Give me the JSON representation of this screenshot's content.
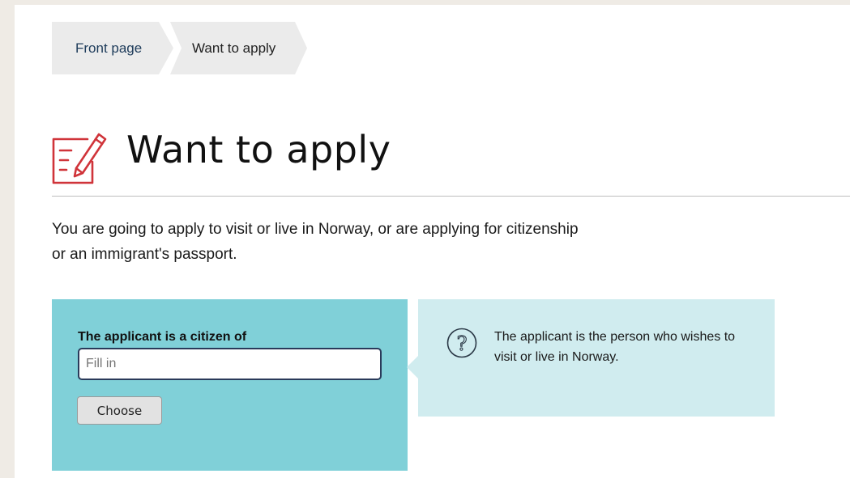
{
  "breadcrumb": {
    "items": [
      {
        "label": "Front page"
      },
      {
        "label": "Want to apply"
      }
    ]
  },
  "header": {
    "title": "Want to apply",
    "icon": "application-form-icon",
    "icon_color": "#d0343a"
  },
  "intro": {
    "text": "You are going to apply to visit or live in Norway, or are applying for citizenship or an immigrant's passport."
  },
  "form": {
    "label": "The applicant is a citizen of",
    "input_placeholder": "Fill in",
    "input_value": "",
    "button_label": "Choose",
    "panel_color": "#80d0d8"
  },
  "help": {
    "icon": "question-mark-icon",
    "text": "The applicant is the person who wishes to visit or live in Norway.",
    "panel_color": "#d0ecef"
  }
}
